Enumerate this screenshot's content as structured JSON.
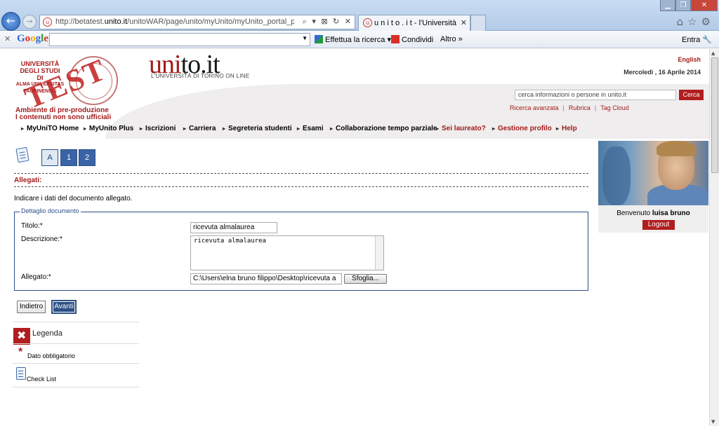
{
  "browser": {
    "url_prefix": "http://betatest.",
    "url_domain": "unito.it",
    "url_rest": "/unitoWAR/page/unito/myUnito/myUnito_portal_page_segrete",
    "tab_title": "u n i t o . i t - l'Università di ...",
    "address_icons": "⌕ ▾ ⊠ ↻ ✕"
  },
  "google_toolbar": {
    "logo": "Google",
    "search_label": "Effettua la ricerca",
    "share_label": "Condividi",
    "more_label": "Altro",
    "enter_label": "Entra"
  },
  "header": {
    "university_lines": [
      "UNIVERSITÀ",
      "DEGLI STUDI",
      "DI",
      "ALMA UNIVERSITAS",
      "TAURINENSIS"
    ],
    "stamp": "TEST",
    "preprod_line1": "Ambiente di pre-produzione",
    "preprod_line2": "I contenuti non sono ufficiali",
    "site_name_left": "uni",
    "site_name_right": "to.it",
    "site_subtitle": "L'UNIVERSITÀ DI TORINO ON LINE",
    "language": "English",
    "date": "Mercoledì , 16 Aprile 2014",
    "search_placeholder": "cerca informazioni o persone in unito.it",
    "search_button": "Cerca",
    "links": [
      "Ricerca avanzata",
      "Rubrica",
      "Tag Cloud"
    ]
  },
  "menu": [
    "MyUniTO Home",
    "MyUnito Plus",
    "Iscrizioni",
    "Carriera",
    "Segreteria studenti",
    "Esami",
    "Collaborazione tempo parziale",
    "Sei laureato?",
    "Gestione profilo",
    "Help"
  ],
  "steps": [
    "A",
    "1",
    "2"
  ],
  "section": {
    "title": "Allegati:",
    "instructions": "Indicare i dati del documento allegato.",
    "fieldset_legend": "Dettaglio documento",
    "titolo_label": "Titolo:*",
    "titolo_value": "ricevuta almalaurea",
    "descrizione_label": "Descrizione:*",
    "descrizione_value": "ricevuta almalaurea",
    "allegato_label": "Allegato:*",
    "allegato_value": "C:\\Users\\elna bruno filippo\\Desktop\\ricevuta a",
    "browse_button": "Sfoglia..."
  },
  "actions": {
    "back": "Indietro",
    "next": "Avanti"
  },
  "legend": {
    "title": "Legenda",
    "required": "Dato obbligatorio",
    "checklist": "Check List"
  },
  "user": {
    "welcome_prefix": "Benvenuto ",
    "name": "luisa bruno",
    "logout": "Logout"
  },
  "colors": {
    "brand_red": "#a31b1b",
    "button_blue": "#2c4f86"
  }
}
